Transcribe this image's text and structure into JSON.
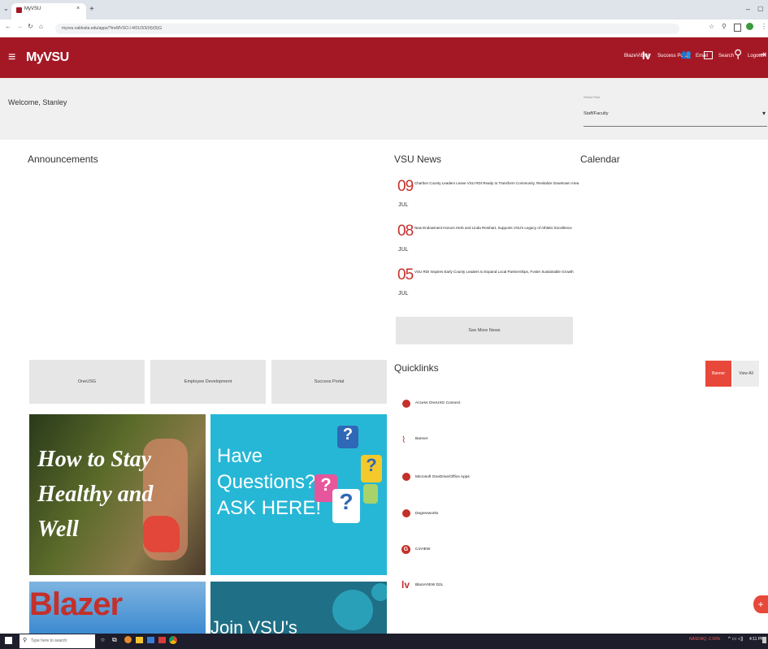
{
  "browser": {
    "tab_title": "MyVSU",
    "url": "myvsu.valdosta.edu/apps/?tnvMVSO.I.4/01/3/3/(4)/(6)G"
  },
  "header": {
    "logo": "MyVSU",
    "links": [
      "BlazeVIEW",
      "Success Portal",
      "Email",
      "Search",
      "Logout"
    ]
  },
  "welcome": {
    "text": "Welcome, Stanley",
    "role_label": "Select Role",
    "role_value": "Staff/Faculty"
  },
  "announcements": {
    "title": "Announcements",
    "buttons": [
      "OneUSG",
      "Employee Development",
      "Success Portal"
    ]
  },
  "promos": [
    {
      "text": "How to Stay Healthy and Well"
    },
    {
      "text": "Have Questions? ASK HERE!"
    },
    {
      "text": "Blazer"
    },
    {
      "text": "Join VSU's"
    }
  ],
  "news": {
    "title": "VSU News",
    "items": [
      {
        "day": "09",
        "month": "JUL",
        "headline": "Charlton County Leaders Leave VSU RDI Ready to Transform Community, Revitalize Downtown Area"
      },
      {
        "day": "08",
        "month": "JUL",
        "headline": "New Endowment Honors Herb and Linda Reinhart, Supports VSU's Legacy of Athletic Excellence"
      },
      {
        "day": "05",
        "month": "JUL",
        "headline": "VSU RDI Inspires Early County Leaders to Expand Local Partnerships, Foster Sustainable Growth"
      }
    ],
    "more_label": "See More News"
  },
  "calendar": {
    "title": "Calendar"
  },
  "quicklinks": {
    "title": "Quicklinks",
    "filter_active": "Banner",
    "filter_all": "View All",
    "items": [
      "Access OneUSG Connect",
      "Banner",
      "Microsoft OneDrive/Office Apps",
      "Degreeworks",
      "CoVIEW",
      "BlazeVIEW D2L"
    ]
  },
  "taskbar": {
    "search_placeholder": "Type here to search",
    "stock": "NASDAQ -2.09%",
    "time": "4:11 PM"
  },
  "colors": {
    "brand": "#a41825",
    "accent": "#e8483a"
  }
}
